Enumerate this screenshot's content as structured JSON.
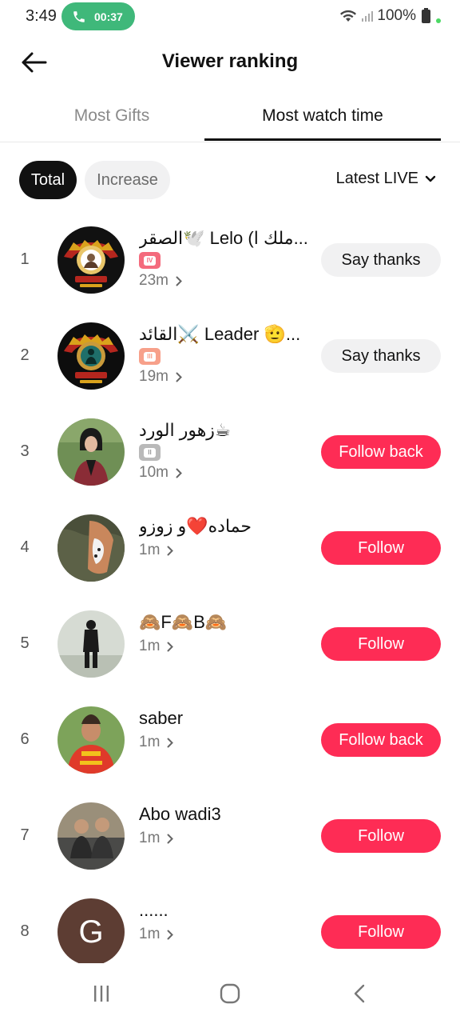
{
  "status_bar": {
    "time": "3:49",
    "call_duration": "00:37",
    "battery": "100%",
    "call_color": "#3fb87a"
  },
  "header": {
    "title": "Viewer ranking"
  },
  "tabs": [
    {
      "label": "Most Gifts",
      "active": false
    },
    {
      "label": "Most watch time",
      "active": true
    }
  ],
  "filters": {
    "total_label": "Total",
    "increase_label": "Increase",
    "scope_label": "Latest LIVE"
  },
  "colors": {
    "accent": "#fe2c55",
    "secondary_button": "#f1f1f2"
  },
  "ranking": [
    {
      "rank": "1",
      "name": "الصقر🕊️ Lelo (ملك ا...",
      "watch_time": "23m",
      "action": "Say thanks",
      "badge": "IV",
      "badge_color": "#f46b7d",
      "avatar_icon": "crest-avatar"
    },
    {
      "rank": "2",
      "name": "القائد⚔️ Leader 🫡...",
      "watch_time": "19m",
      "action": "Say thanks",
      "badge": "III",
      "badge_color": "#f7a08a",
      "avatar_icon": "crest-avatar"
    },
    {
      "rank": "3",
      "name": "زهور الورد☕",
      "watch_time": "10m",
      "action": "Follow back",
      "badge": "II",
      "badge_color": "#b9b9b9",
      "avatar_icon": "photo-avatar"
    },
    {
      "rank": "4",
      "name": "حماده❤️و زوزو",
      "watch_time": "1m",
      "action": "Follow",
      "badge": "",
      "badge_color": "",
      "avatar_icon": "photo-avatar"
    },
    {
      "rank": "5",
      "name": "🙈F🙈B🙈",
      "watch_time": "1m",
      "action": "Follow",
      "badge": "",
      "badge_color": "",
      "avatar_icon": "photo-avatar"
    },
    {
      "rank": "6",
      "name": "saber",
      "watch_time": "1m",
      "action": "Follow back",
      "badge": "",
      "badge_color": "",
      "avatar_icon": "photo-avatar"
    },
    {
      "rank": "7",
      "name": "Abo wadi3",
      "watch_time": "1m",
      "action": "Follow",
      "badge": "",
      "badge_color": "",
      "avatar_icon": "photo-avatar"
    },
    {
      "rank": "8",
      "name": "......",
      "watch_time": "1m",
      "action": "Follow",
      "badge": "",
      "badge_color": "",
      "avatar_icon": "letter-avatar",
      "avatar_letter": "G"
    }
  ],
  "navbar": {
    "items": [
      "recent-apps-icon",
      "home-icon",
      "back-icon"
    ]
  }
}
